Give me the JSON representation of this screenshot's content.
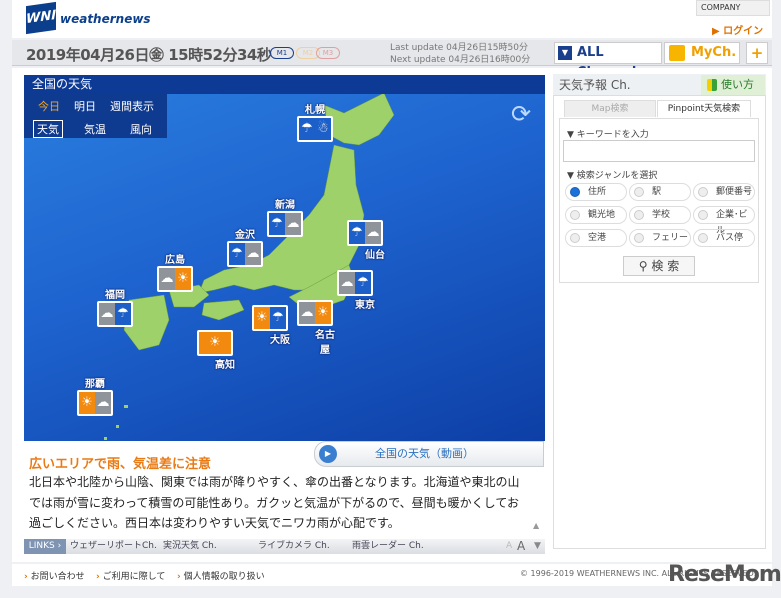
{
  "header": {
    "logo": "WNI",
    "brand": "weathernews",
    "company": "COMPANY",
    "login": "ログイン"
  },
  "datebar": {
    "date": "2019年04月26日㊎ 15時52分34秒",
    "modes": [
      "M1",
      "M2",
      "M3"
    ],
    "last_update": "Last update  04月26日15時50分",
    "next_update": "Next update  04月26日16時00分",
    "all_channel": "ALL Channel",
    "mych": "MyCh.",
    "plus": "+"
  },
  "map": {
    "title": "全国の天気",
    "day_tabs": [
      "今日",
      "明日",
      "週間表示"
    ],
    "type_tabs": [
      "天気",
      "気温",
      "風向"
    ],
    "cities": [
      {
        "name": "札幌",
        "icons": [
          "☂",
          "☃"
        ]
      },
      {
        "name": "新潟",
        "icons": [
          "☂",
          "☁"
        ]
      },
      {
        "name": "仙台",
        "icons": [
          "☂",
          "☁"
        ]
      },
      {
        "name": "金沢",
        "icons": [
          "☂",
          "☁"
        ]
      },
      {
        "name": "広島",
        "icons": [
          "☁",
          "☀"
        ]
      },
      {
        "name": "東京",
        "icons": [
          "☁",
          "☂"
        ]
      },
      {
        "name": "福岡",
        "icons": [
          "☁",
          "☂"
        ]
      },
      {
        "name": "大阪",
        "icons": [
          "☀",
          "☂"
        ]
      },
      {
        "name": "名古屋",
        "icons": [
          "☁",
          "☀"
        ]
      },
      {
        "name": "高知",
        "icons": [
          "☀"
        ]
      },
      {
        "name": "那覇",
        "icons": [
          "☀",
          "☁"
        ]
      }
    ],
    "video": "全国の天気（動画）"
  },
  "news": {
    "headline": "広いエリアで雨、気温差に注意",
    "body": "北日本や北陸から山陰、関東では雨が降りやすく、傘の出番となります。北海道や東北の山では雨が雪に変わって積雪の可能性あり。ガクッと気温が下がるので、昼間も暖かくしてお過ごしください。西日本は変わりやすい天気でニワカ雨が心配です。"
  },
  "links": {
    "label": "LINKS ›",
    "items": [
      "ウェザーリポートCh.",
      "実況天気 Ch.",
      "ライブカメラ Ch.",
      "雨雲レーダー Ch."
    ],
    "font_small": "A",
    "font_large": "A"
  },
  "side": {
    "title": "天気予報 Ch.",
    "howto": "使い方",
    "tabs": [
      "Map検索",
      "Pinpoint天気検索"
    ],
    "keyword_label": "▼ キーワードを入力",
    "keyword_value": "",
    "genre_label": "▼ 検索ジャンルを選択",
    "genres": [
      "住所",
      "駅",
      "郵便番号",
      "観光地",
      "学校",
      "企業･ビル",
      "空港",
      "フェリー",
      "バス停"
    ],
    "search": "検 索"
  },
  "footer": {
    "links": [
      "お問い合わせ",
      "ご利用に際して",
      "個人情報の取り扱い"
    ],
    "copyright": "© 1996-2019 WEATHERNEWS INC. ALL RIGHTS RESERVED.",
    "watermark": "ReseMom"
  }
}
